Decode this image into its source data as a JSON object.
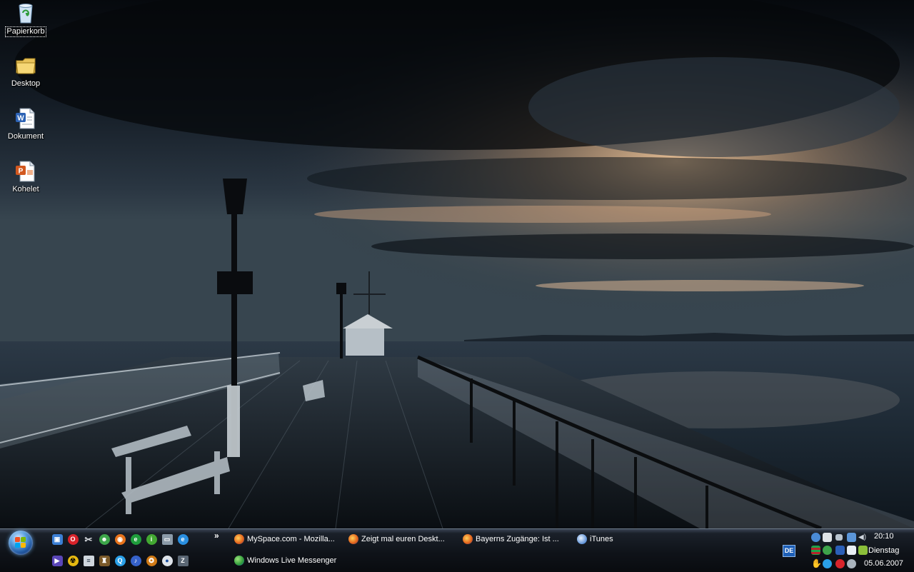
{
  "desktop": {
    "icons": [
      {
        "label": "Papierkorb",
        "icon": "recycle-bin-icon"
      },
      {
        "label": "Desktop",
        "icon": "folder-icon"
      },
      {
        "label": "Dokument",
        "icon": "word-document-icon"
      },
      {
        "label": "Kohelet",
        "icon": "powerpoint-document-icon"
      }
    ]
  },
  "taskbar": {
    "more_label": "»",
    "tasks": [
      {
        "label": "MySpace.com - Mozilla...",
        "icon": "firefox-icon"
      },
      {
        "label": "Zeigt mal euren Deskt...",
        "icon": "firefox-icon"
      },
      {
        "label": "Bayerns Zugänge: Ist ...",
        "icon": "firefox-icon"
      },
      {
        "label": "iTunes",
        "icon": "itunes-icon"
      },
      {
        "label": "Windows Live Messenger",
        "icon": "messenger-icon"
      }
    ],
    "language": "DE",
    "clock": {
      "time": "20:10",
      "day": "Dienstag",
      "date": "05.06.2007"
    }
  },
  "colors": {
    "taskbar": "#0f1319",
    "start_orb": "#1f63bd",
    "sky_glow": "#e6b98e"
  }
}
